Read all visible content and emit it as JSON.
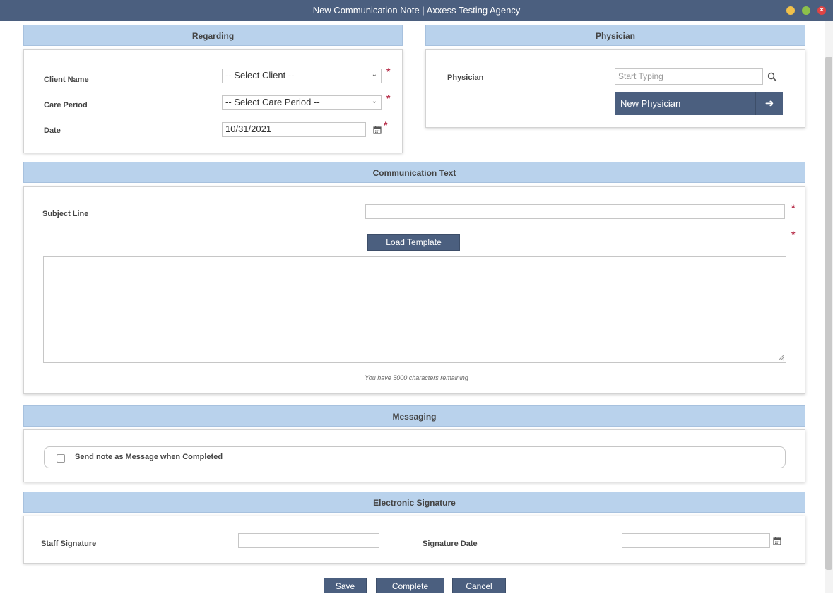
{
  "window": {
    "title": "New Communication Note | Axxess Testing Agency",
    "close_glyph": "×"
  },
  "regarding": {
    "header": "Regarding",
    "client_label": "Client Name",
    "client_value": "-- Select Client --",
    "care_period_label": "Care Period",
    "care_period_value": "-- Select Care Period --",
    "date_label": "Date",
    "date_value": "10/31/2021"
  },
  "physician": {
    "header": "Physician",
    "label": "Physician",
    "placeholder": "Start Typing",
    "new_button": "New Physician",
    "arrow": "➜"
  },
  "communication": {
    "header": "Communication Text",
    "subject_label": "Subject Line",
    "load_template": "Load Template",
    "remaining": "You have 5000 characters remaining"
  },
  "messaging": {
    "header": "Messaging",
    "checkbox_label": "Send note as Message when Completed"
  },
  "signature": {
    "header": "Electronic Signature",
    "staff_label": "Staff Signature",
    "date_label": "Signature Date"
  },
  "required_marker": "*",
  "actions": {
    "save": "Save",
    "complete": "Complete",
    "cancel": "Cancel"
  },
  "icons": {
    "search": "search-icon",
    "calendar": "calendar-icon",
    "chevron": "chevron-down-icon"
  },
  "colors": {
    "titlebar": "#4b5f7f",
    "section_header": "#b9d2ec",
    "button": "#4b5f7f",
    "required": "#b8324d"
  }
}
